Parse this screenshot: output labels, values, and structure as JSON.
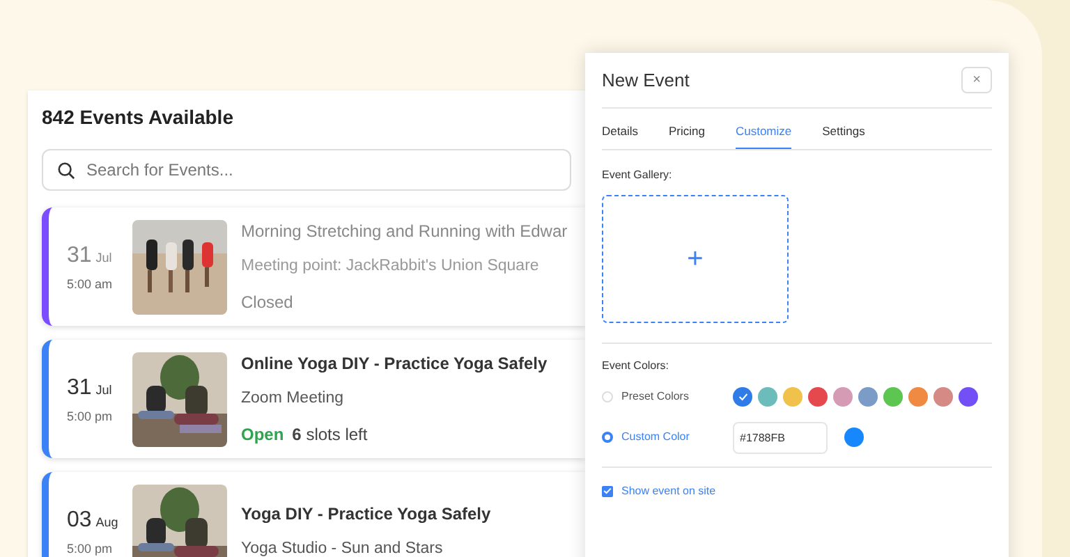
{
  "events_panel": {
    "title": "842 Events Available",
    "search": {
      "placeholder": "Search for Events..."
    },
    "events": [
      {
        "day": "31",
        "month": "Jul",
        "time": "5:00 am",
        "title": "Morning Stretching and Running with Edwar",
        "place": "Meeting point: JackRabbit's Union Square",
        "status": {
          "kind": "closed",
          "label": "Closed"
        },
        "color": "#7c4dff"
      },
      {
        "day": "31",
        "month": "Jul",
        "time": "5:00 pm",
        "title": "Online Yoga DIY - Practice Yoga Safely",
        "place": "Zoom Meeting",
        "status": {
          "kind": "open",
          "label": "Open",
          "slots": "**6** slots left"
        },
        "color": "#3b82f6"
      },
      {
        "day": "03",
        "month": "Aug",
        "time": "5:00 pm",
        "title": "Yoga DIY - Practice Yoga Safely",
        "place": "Yoga Studio - Sun and Stars",
        "color": "#3b82f6"
      }
    ]
  },
  "dialog": {
    "title": "New Event",
    "close": "×",
    "tabs": [
      {
        "label": "Details",
        "selected": false
      },
      {
        "label": "Pricing",
        "selected": false
      },
      {
        "label": "Customize",
        "selected": true
      },
      {
        "label": "Settings",
        "selected": false
      }
    ],
    "gallery_label": "Event Gallery:",
    "gallery_add": "+",
    "colors_label": "Event Colors:",
    "preset": {
      "label": "Preset Colors",
      "selected": false,
      "swatches": [
        {
          "color": "#2f7be8",
          "selected": true
        },
        {
          "color": "#6cbcbc",
          "selected": false
        },
        {
          "color": "#f0c24b",
          "selected": false
        },
        {
          "color": "#e5484d",
          "selected": false
        },
        {
          "color": "#d59bb5",
          "selected": false
        },
        {
          "color": "#7a9cc6",
          "selected": false
        },
        {
          "color": "#5dc651",
          "selected": false
        },
        {
          "color": "#f08a42",
          "selected": false
        },
        {
          "color": "#d58a85",
          "selected": false
        },
        {
          "color": "#7350f5",
          "selected": false
        }
      ]
    },
    "custom": {
      "label": "Custom Color",
      "selected": true,
      "value": "#1788FB",
      "color": "#1788fb"
    },
    "show_on_site": {
      "label": "Show event on site",
      "checked": true
    }
  }
}
